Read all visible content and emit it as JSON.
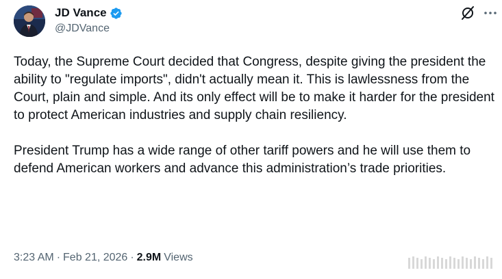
{
  "author": {
    "display_name": "JD Vance",
    "handle": "@JDVance",
    "verified": true
  },
  "header_icons": {
    "grok": "grok-icon",
    "more": "more-icon"
  },
  "tweet": {
    "paragraphs": [
      "Today, the Supreme Court decided that Congress, despite giving the president the ability to \"regulate imports\", didn't actually mean it. This is lawlessness from the Court, plain and simple. And its only effect will be to make it harder for the president to protect American industries and supply chain resiliency.",
      "President Trump has a wide range of other tariff powers and he will use them to defend American workers and advance this administration’s trade priorities."
    ]
  },
  "meta": {
    "time": "3:23 AM",
    "separator": "·",
    "date": "Feb 21, 2026",
    "views_count": "2.9M",
    "views_label": "Views"
  },
  "colors": {
    "text": "#0f1419",
    "secondary": "#536471",
    "verified": "#1d9bf0"
  }
}
